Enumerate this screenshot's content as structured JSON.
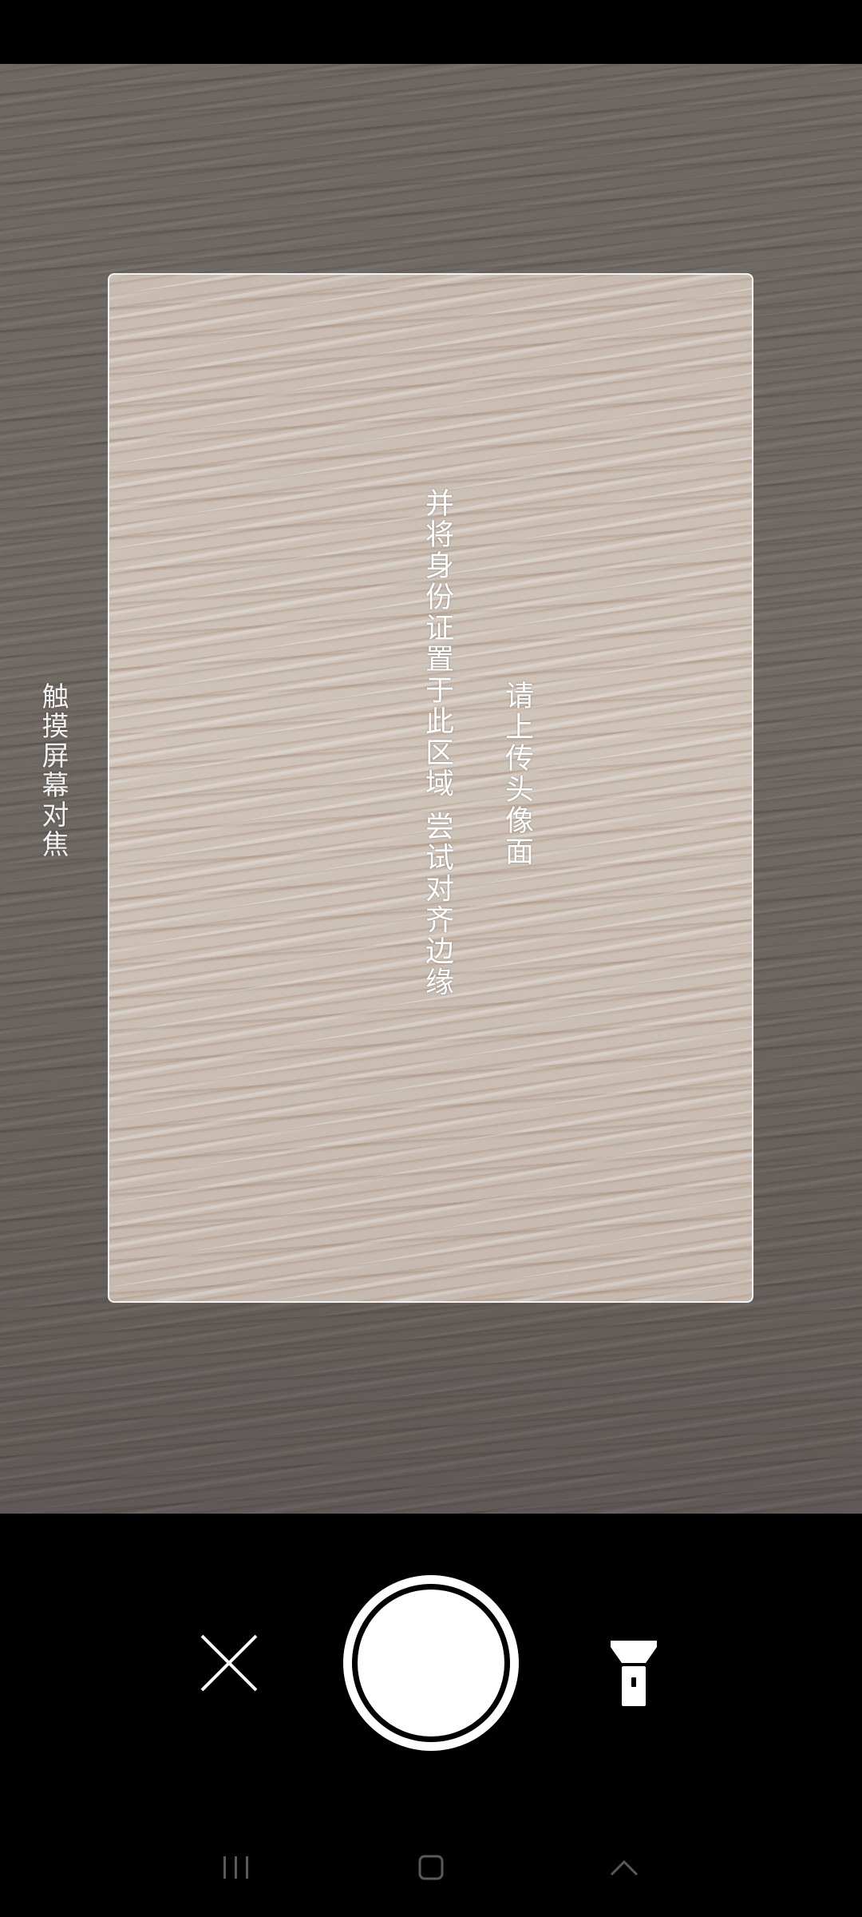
{
  "camera": {
    "hint_line1": "请上传头像面",
    "hint_line2": "并将身份证置于此区域 尝试对齐边缘",
    "focus_hint": "触摸屏幕对焦"
  },
  "controls": {
    "close_icon": "close-icon",
    "shutter_icon": "shutter-icon",
    "flashlight_icon": "flashlight-icon"
  },
  "nav": {
    "recents_icon": "recents-icon",
    "home_icon": "home-icon",
    "back_icon": "chevron-up-icon"
  },
  "colors": {
    "frame_border": "#f2f2f2",
    "bar_background": "#000000",
    "icon_white": "#ffffff",
    "nav_icon_gray": "#5a5a5a"
  }
}
